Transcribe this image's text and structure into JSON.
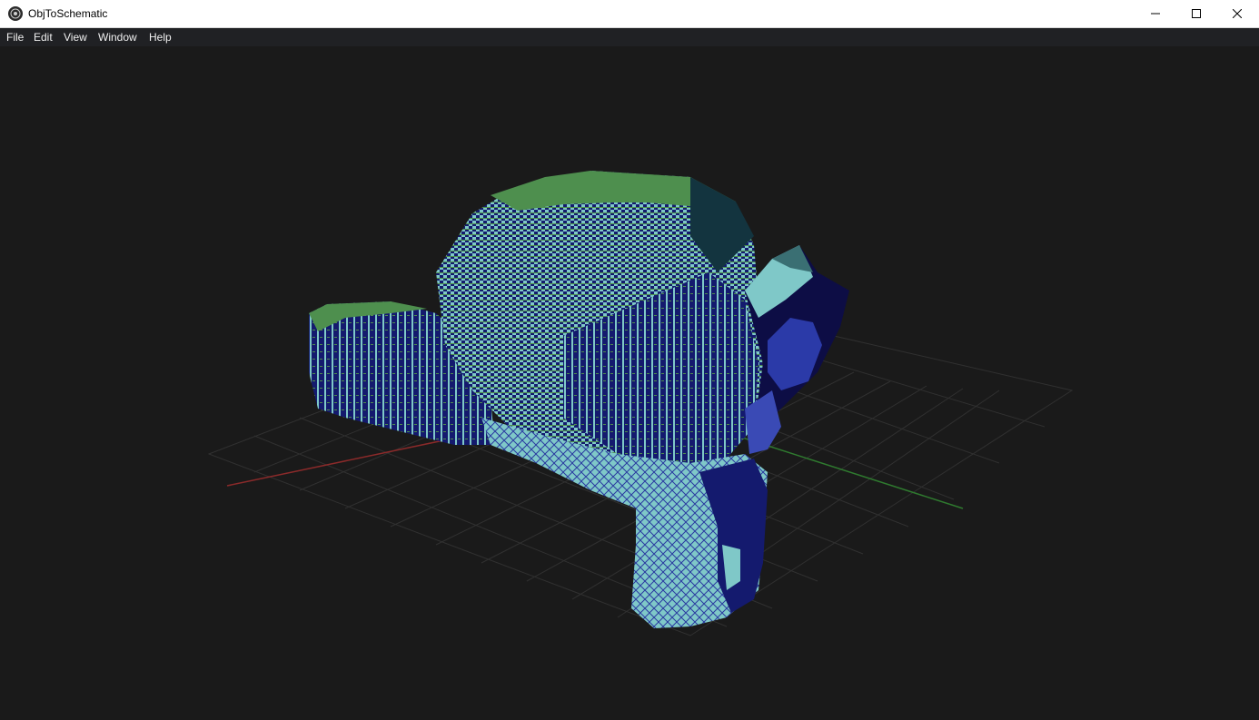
{
  "window": {
    "title": "ObjToSchematic",
    "app_icon": "app-logo-icon",
    "controls": {
      "minimize_icon": "minimize-icon",
      "maximize_icon": "maximize-icon",
      "close_icon": "close-icon"
    }
  },
  "menubar": {
    "items": [
      {
        "label": "File"
      },
      {
        "label": "Edit"
      },
      {
        "label": "View"
      },
      {
        "label": "Window"
      },
      {
        "label": "Help"
      }
    ]
  },
  "viewport": {
    "content": "voxelized-monkey-model",
    "grid": true,
    "colors": {
      "background": "#1a1a1a",
      "grid_line": "#3a3a3a",
      "x_axis": "#8b2a2a",
      "z_axis": "#2f7a2f",
      "voxel_top": "#4e8f4e",
      "voxel_side_light": "#7fc8c8",
      "voxel_side_dark": "#141a6e",
      "mesh_dark": "#0d0d45"
    }
  }
}
